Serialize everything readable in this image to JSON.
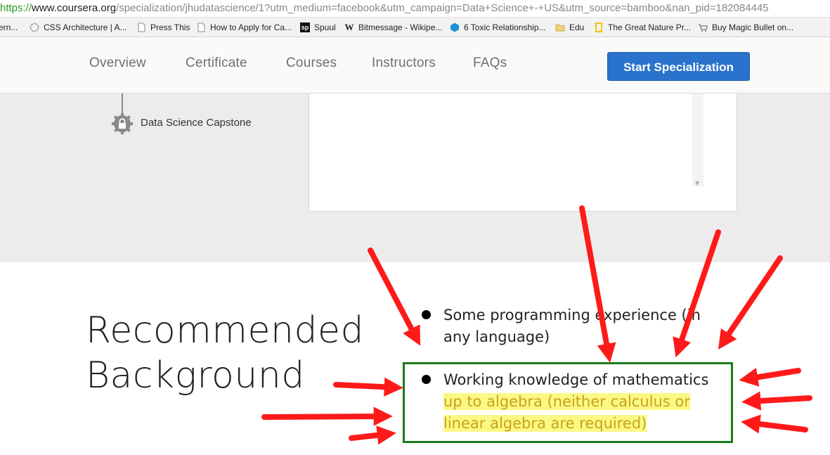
{
  "browser": {
    "url_scheme": "https://",
    "url_host": "www.coursera.org",
    "url_rest": "/specialization/jhudatascience/1?utm_medium=facebook&utm_campaign=Data+Science+-+US&utm_source=bamboo&nan_pid=182084445",
    "bookmarks": [
      {
        "label": "ern...",
        "icon": "none"
      },
      {
        "label": "CSS Architecture | A...",
        "icon": "dotted-circle-icon"
      },
      {
        "label": "Press This",
        "icon": "page-icon"
      },
      {
        "label": "How to Apply for Ca...",
        "icon": "page-icon"
      },
      {
        "label": "Spuul",
        "icon": "sp-logo-icon",
        "icon_text": "sp"
      },
      {
        "label": "Bitmessage - Wikipe...",
        "icon": "wikipedia-icon",
        "icon_text": "W"
      },
      {
        "label": "6 Toxic Relationship...",
        "icon": "hexagon-icon"
      },
      {
        "label": "Edu",
        "icon": "folder-icon"
      },
      {
        "label": "The Great Nature Pr...",
        "icon": "natgeo-icon"
      },
      {
        "label": "Buy Magic Bullet on...",
        "icon": "cart-icon"
      }
    ]
  },
  "nav": {
    "links": [
      "Overview",
      "Certificate",
      "Courses",
      "Instructors",
      "FAQs"
    ],
    "cta_label": "Start Specialization",
    "accent": "#2a73cc"
  },
  "timeline": {
    "capstone_label": "Data Science Capstone"
  },
  "recommended": {
    "title_line1": "Recommended",
    "title_line2": "Background",
    "items": [
      {
        "line1": "Some programming experience (in",
        "line2": "any language)"
      },
      {
        "line1": "Working knowledge of mathematics",
        "line2": "up to algebra (neither calculus or",
        "line3": "linear algebra are required)"
      }
    ],
    "highlight_color": "#fbf885",
    "box_color": "#1a7a1a",
    "arrow_color": "#ff1a1a"
  }
}
